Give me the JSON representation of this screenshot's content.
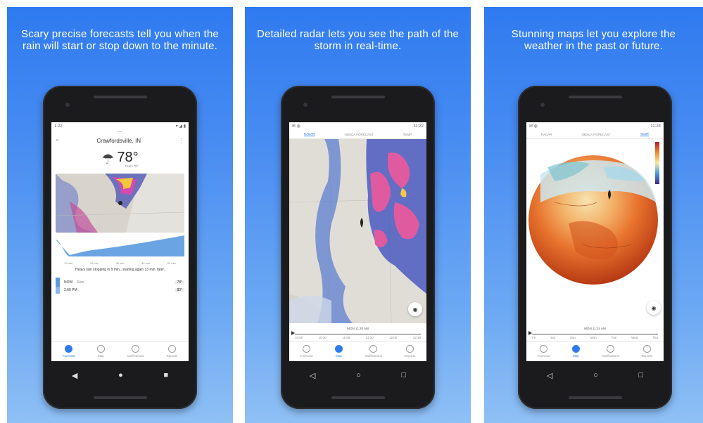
{
  "panels": [
    {
      "caption": "Scary precise forecasts tell you when the rain will start or stop down to the minute.",
      "status_time": "1:22",
      "city": "Crawfordsville, IN",
      "temperature": "78°",
      "feels_like": "Feels 78°",
      "summary": "Heavy rain stopping in 9 min., starting again 13 min. later.",
      "chart_ticks": [
        "10 min",
        "20 min",
        "30 min",
        "40 min",
        "50 min"
      ],
      "row_now_label": "NOW",
      "row_now_desc": "Rain",
      "row_now_temp": "78°",
      "row_next_label": "2:00 PM",
      "row_next_temp": "80°",
      "nav": [
        "Forecast",
        "Map",
        "Notifications",
        "Reports"
      ]
    },
    {
      "caption": "Detailed radar lets you see the path of the storm in real-time.",
      "status_time": "11:22",
      "tabs": [
        "RADAR",
        "OBSCA FORECAST",
        "TEMP"
      ],
      "timeline_label": "MON 11:20 AM",
      "timeline_ticks": [
        "10:00",
        "10:30",
        "11:00",
        "11:30",
        "12:00",
        "12:30"
      ],
      "nav": [
        "Forecast",
        "Map",
        "Notifications",
        "Reports"
      ]
    },
    {
      "caption": "Stunning maps let you explore the weather in the past or future.",
      "status_time": "11:24",
      "tabs": [
        "RADAR",
        "OBSCA FORECAST",
        "TEMP"
      ],
      "timeline_label": "MON 11:24 AM",
      "timeline_ticks": [
        "Fri",
        "Sat",
        "Sun",
        "Mon",
        "Tue",
        "Wed",
        "Thu"
      ],
      "nav": [
        "Forecast",
        "Map",
        "Notifications",
        "Reports"
      ]
    }
  ],
  "colors": {
    "accent": "#2f7af0",
    "background_top": "#2f7af0",
    "background_bottom": "#8fc0f5"
  }
}
